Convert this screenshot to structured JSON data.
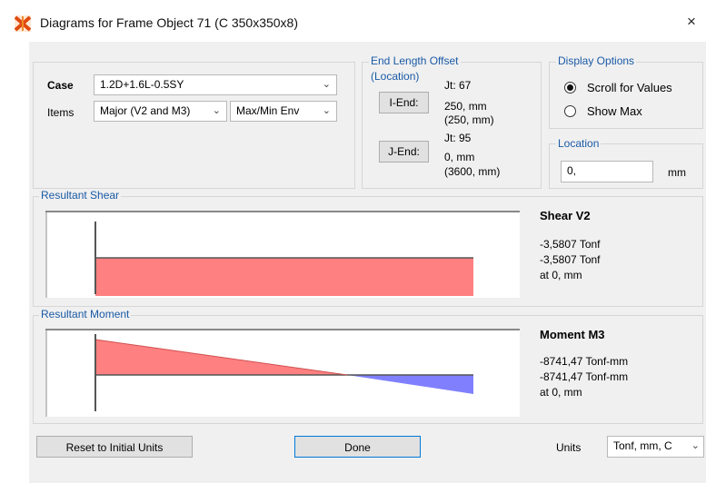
{
  "window": {
    "title": "Diagrams for Frame Object 71  (C 350x350x8)",
    "close_glyph": "×"
  },
  "case": {
    "label": "Case",
    "value": "1.2D+1.6L-0.5SY"
  },
  "items": {
    "label": "Items",
    "value": "Major (V2 and M3)",
    "env_value": "Max/Min Env"
  },
  "end_offset": {
    "title": "End Length Offset",
    "subtitle": "(Location)",
    "i_button": "I-End:",
    "j_button": "J-End:",
    "i_jt": "Jt:  67",
    "i_len": "250, mm",
    "i_loc": "(250, mm)",
    "j_jt": "Jt:  95",
    "j_len": "0, mm",
    "j_loc": "(3600, mm)"
  },
  "display_options": {
    "title": "Display Options",
    "options": [
      {
        "label": "Scroll for Values",
        "selected": true
      },
      {
        "label": "Show Max",
        "selected": false
      }
    ]
  },
  "location": {
    "title": "Location",
    "value": "0,",
    "unit": "mm"
  },
  "shear": {
    "section_title": "Resultant Shear",
    "panel_title": "Shear V2",
    "line1": "-3,5807 Tonf",
    "line2": "-3,5807 Tonf",
    "line3": "at 0, mm"
  },
  "moment": {
    "section_title": "Resultant Moment",
    "panel_title": "Moment M3",
    "line1": "-8741,47 Tonf-mm",
    "line2": "-8741,47 Tonf-mm",
    "line3": "at 0, mm"
  },
  "footer": {
    "reset_label": "Reset to Initial Units",
    "done_label": "Done",
    "units_label": "Units",
    "units_value": "Tonf, mm, C"
  },
  "colors": {
    "positive_fill": "#ff8080",
    "negative_fill": "#8080ff",
    "accent_text": "#1a5aa6"
  }
}
